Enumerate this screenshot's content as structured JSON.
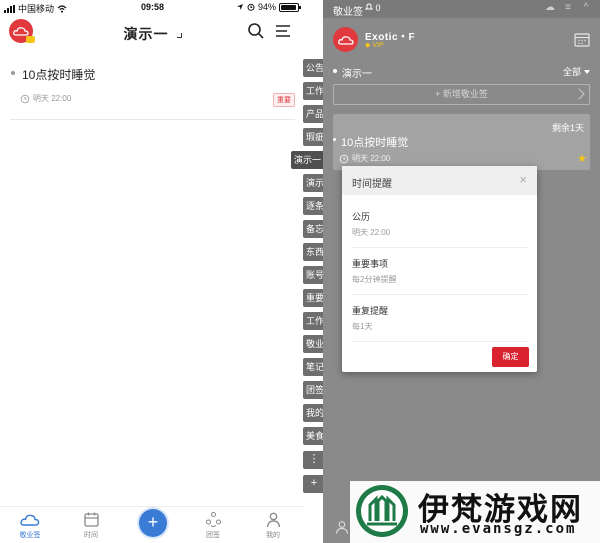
{
  "mobile": {
    "status_bar": {
      "carrier": "中国移动",
      "time": "09:58",
      "battery": "94%"
    },
    "header": {
      "title": "演示一"
    },
    "note": {
      "title": "10点按时睡觉",
      "due": "明天 22:00",
      "tag": "重要"
    },
    "tabbar": {
      "items": [
        {
          "label": "敬业签",
          "icon": "cloud-note-icon",
          "active": true
        },
        {
          "label": "时间",
          "icon": "calendar-icon",
          "active": false
        },
        {
          "label": "",
          "icon": "plus-icon",
          "active": false
        },
        {
          "label": "团签",
          "icon": "team-icon",
          "active": false
        },
        {
          "label": "我的",
          "icon": "user-icon",
          "active": false
        }
      ]
    }
  },
  "side_tabs": {
    "items": [
      "公告",
      "工作",
      "产品",
      "瑕疵",
      "演示一",
      "演示",
      "逐条",
      "备忘",
      "东西",
      "账号",
      "重要",
      "工作",
      "敬业",
      "笔记",
      "团签",
      "我的",
      "美食"
    ],
    "active": "演示一",
    "more_label": "⋮",
    "add_label": "+"
  },
  "desktop": {
    "titlebar": {
      "app_name": "敬业签",
      "badge": "0"
    },
    "user": {
      "name": "Exotic・F",
      "vip": "VIP"
    },
    "folder": {
      "name": "演示一",
      "filter": "全部"
    },
    "new_note_label": "+ 新增敬业签",
    "card": {
      "remaining": "剩余1天",
      "title": "10点按时睡觉",
      "due": "明天 22:00"
    },
    "reminder_modal": {
      "title": "时间提醒",
      "rows": [
        {
          "label": "公历",
          "value": "明天 22:00"
        },
        {
          "label": "重要事项",
          "value": "每2分钟提醒"
        },
        {
          "label": "重复提醒",
          "value": "每1天"
        }
      ],
      "confirm_label": "确定"
    }
  },
  "watermark": {
    "brand": "伊梵游戏网",
    "url": "www.evansgz.com"
  },
  "colors": {
    "brand_red": "#e0393e",
    "accent_blue": "#3a7bd5",
    "vip_gold": "#f5c518",
    "app_gray": "#8a8a8a"
  }
}
